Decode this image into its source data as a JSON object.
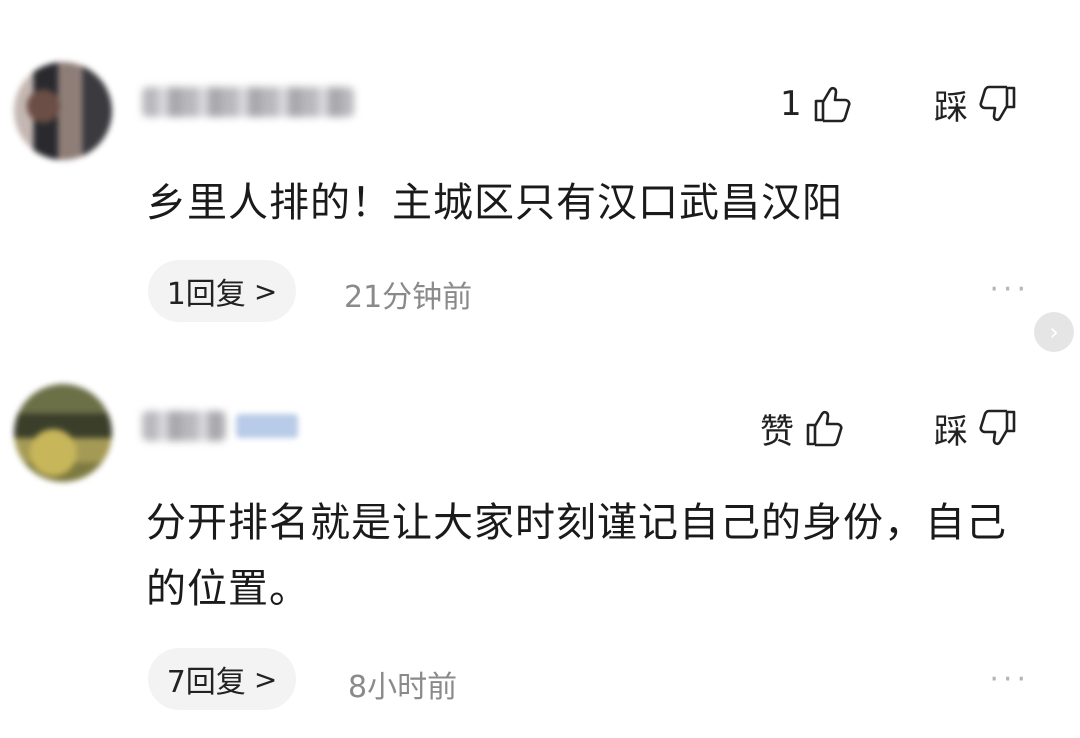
{
  "comments": [
    {
      "like_label": "1",
      "dislike_label": "踩",
      "text": "乡里人排的！主城区只有汉口武昌汉阳",
      "replies_label": "1回复",
      "time": "21分钟前",
      "more": "···"
    },
    {
      "like_label": "赞",
      "dislike_label": "踩",
      "text": "分开排名就是让大家时刻谨记自己的身份，自己的位置。",
      "replies_label": "7回复",
      "time": "8小时前",
      "more": "···"
    }
  ],
  "icons": {
    "like": "thumbs-up-icon",
    "dislike": "thumbs-down-icon",
    "chevron": "chevron-right-icon"
  },
  "side_arrow": "›"
}
